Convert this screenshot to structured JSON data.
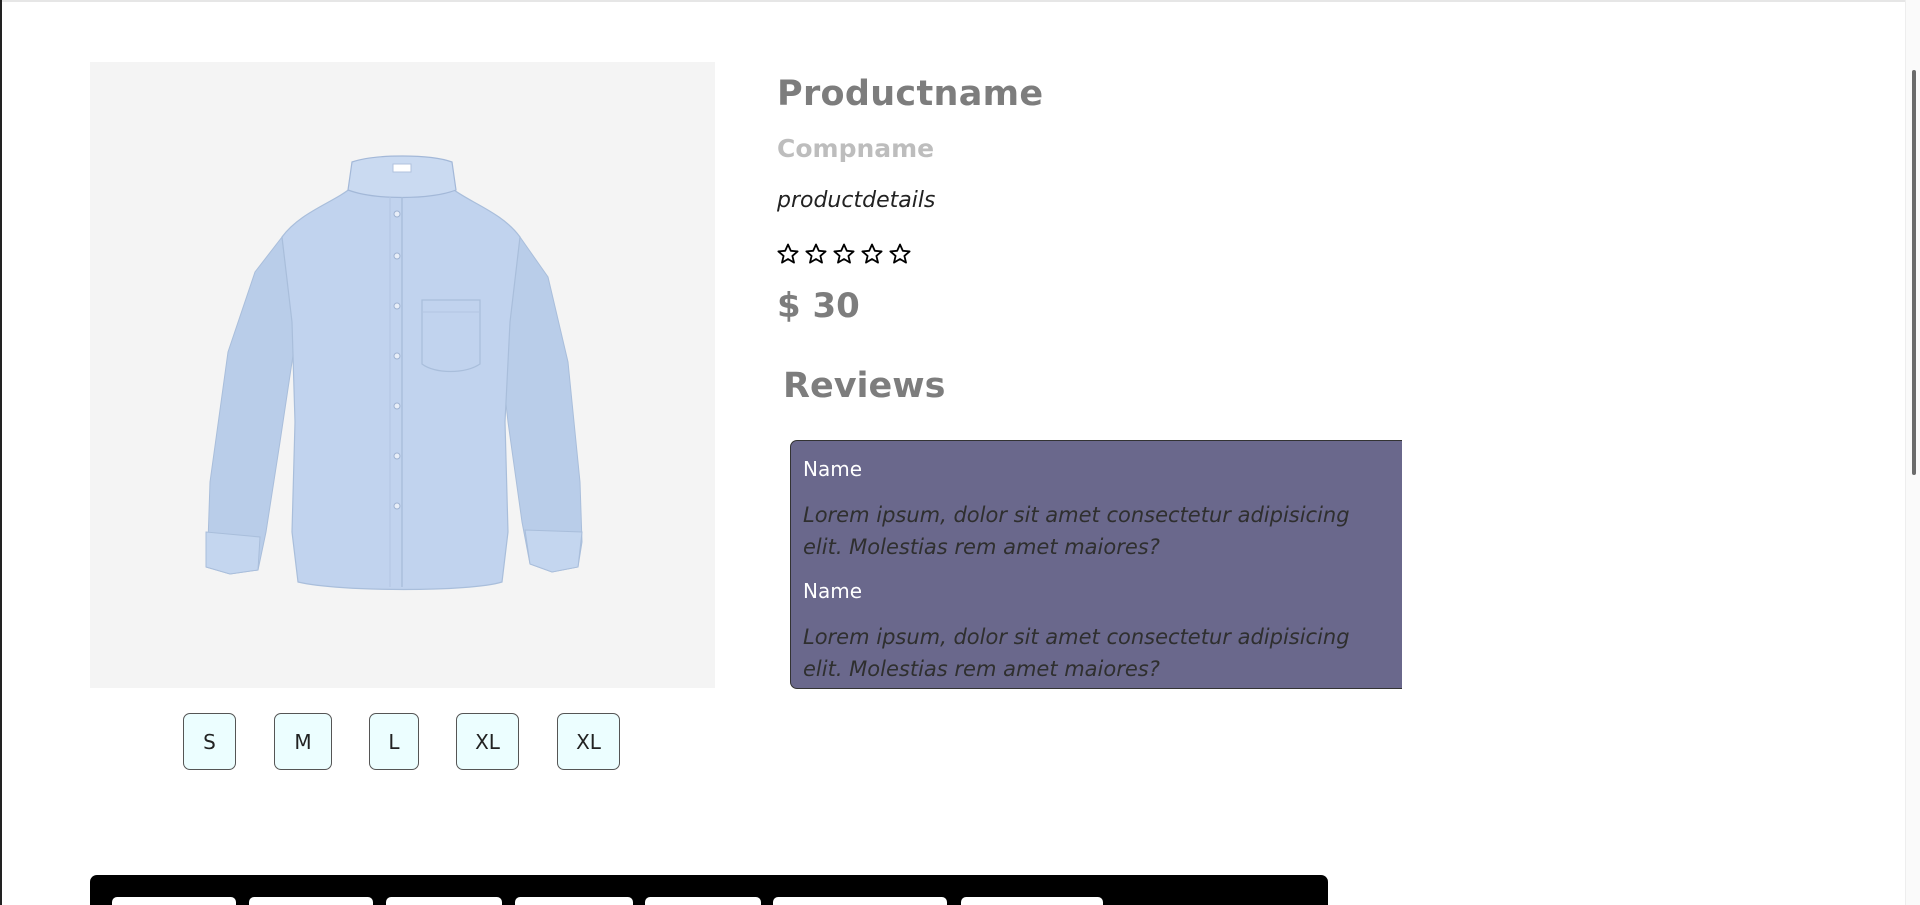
{
  "product": {
    "name": "Productname",
    "company": "Compname",
    "details": "productdetails",
    "rating": {
      "filled": 0,
      "max": 5
    },
    "price": "$ 30",
    "image_icon": "shirt-image"
  },
  "sizes": [
    "S",
    "M",
    "L",
    "XL",
    "XL"
  ],
  "reviews": {
    "heading": "Reviews",
    "items": [
      {
        "name": "Name",
        "text": "Lorem ipsum, dolor sit amet consectetur adipisicing elit. Molestias rem amet maiores?"
      },
      {
        "name": "Name",
        "text": "Lorem ipsum, dolor sit amet consectetur adipisicing elit. Molestias rem amet maiores?"
      }
    ]
  },
  "colors": {
    "review_bg": "#6a688c",
    "size_bg": "#ecfeff",
    "heading": "#7d7d7d",
    "subheading": "#bdbdbd"
  }
}
